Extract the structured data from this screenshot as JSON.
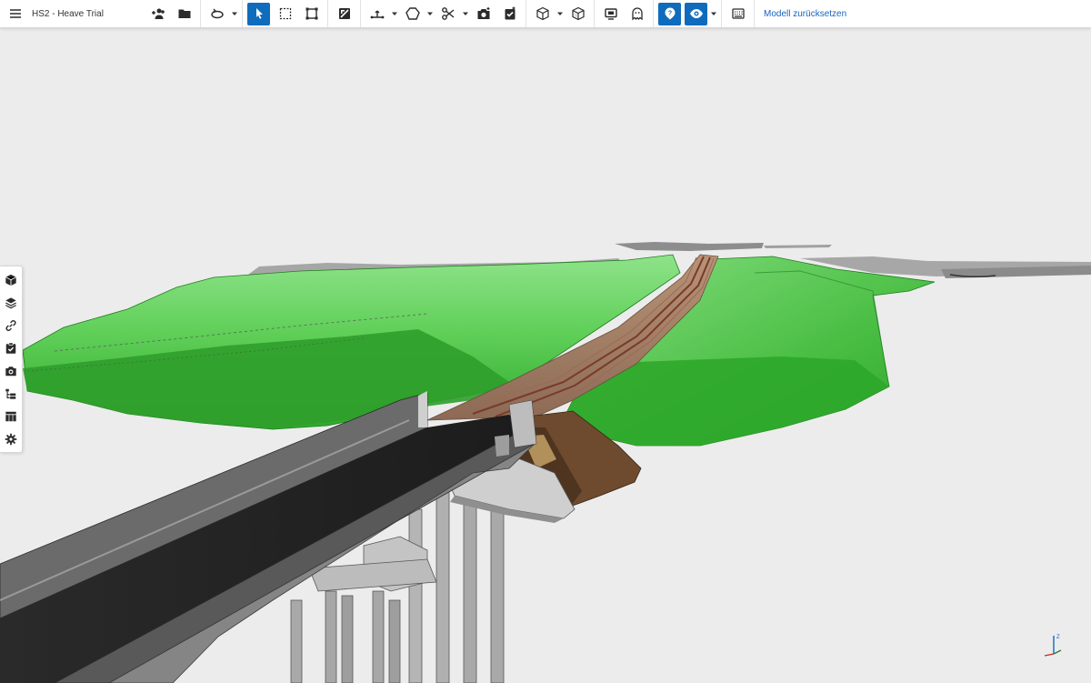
{
  "app": {
    "project_title": "HS2 - Heave Trial",
    "reset_model_label": "Modell zurücksetzen"
  },
  "toolbar": {
    "icons": [
      "menu-icon",
      "add-users-icon",
      "folder-icon",
      "orbit-icon",
      "select-arrow-icon",
      "box-select-icon",
      "region-select-icon",
      "section-plane-icon",
      "measure-icon",
      "polygon-icon",
      "scissors-icon",
      "add-snapshot-icon",
      "clipboard-check-icon",
      "cube-outline-icon",
      "cube-icon",
      "screen-share-icon",
      "ghost-icon",
      "help-bubble-icon",
      "eye-icon",
      "ruler-icon"
    ],
    "active_buttons": [
      "select-arrow-icon",
      "help-bubble-icon",
      "eye-icon"
    ],
    "accent_color": "#0f6cbd"
  },
  "side_toolbar": {
    "icons": [
      "cube-filled-icon",
      "layers-icon",
      "link-icon",
      "task-check-icon",
      "camera-icon",
      "tree-list-icon",
      "table-icon",
      "settings-gear-icon"
    ]
  },
  "viewport": {
    "background": "#ececec",
    "terrain_color": "#3fb63c",
    "track_color": "#b9927a",
    "bridge_color": "#454545"
  },
  "axis_gizmo": {
    "z_label": "Z"
  }
}
